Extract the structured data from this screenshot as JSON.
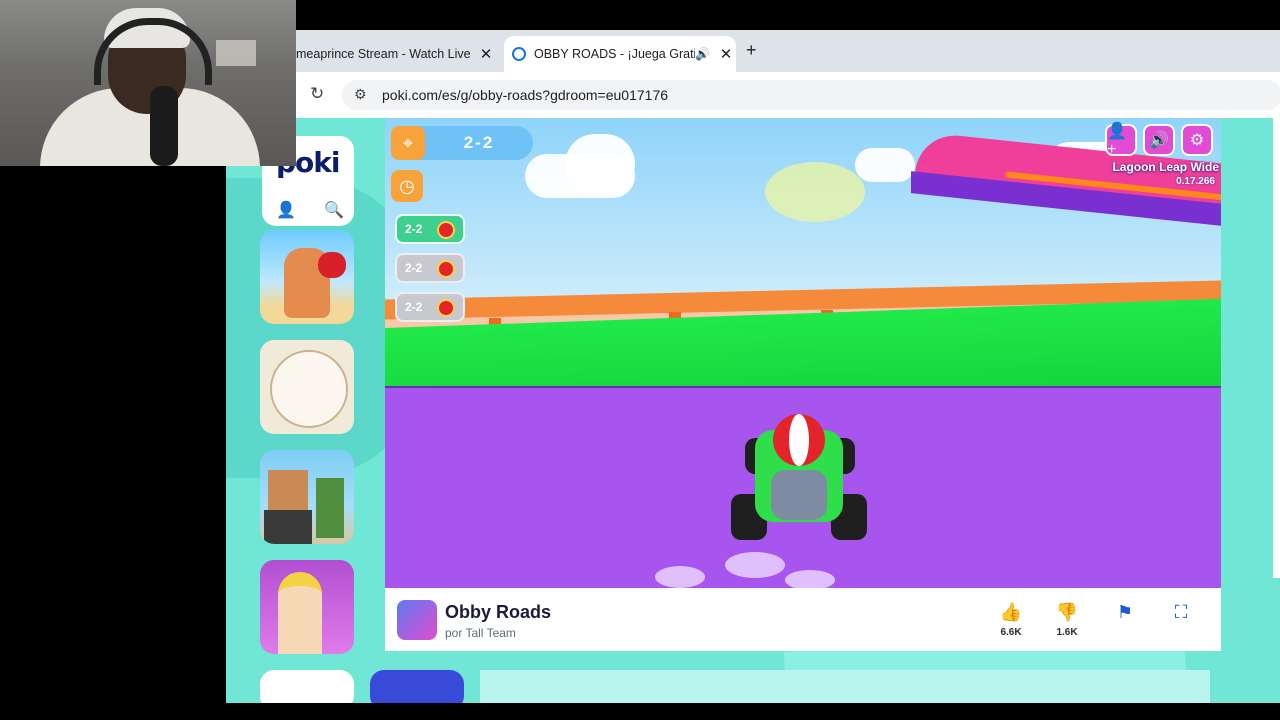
{
  "browser": {
    "tabs": [
      {
        "title": "meaprince Stream - Watch Live"
      },
      {
        "title": "OBBY ROADS - ¡Juega Grati"
      }
    ],
    "url": "poki.com/es/g/obby-roads?gdroom=eu017176"
  },
  "site": {
    "logo": "poki"
  },
  "game": {
    "level": "2-2",
    "racers": [
      {
        "level": "2-2"
      },
      {
        "level": "2-2"
      },
      {
        "level": "2-2"
      }
    ],
    "map_name": "Lagoon Leap Wide",
    "map_code": "0.17.266"
  },
  "info": {
    "title": "Obby Roads",
    "author": "por Tall Team",
    "likes": "6.6K",
    "dislikes": "1.6K"
  },
  "icons": [
    "close-icon",
    "speaker-icon",
    "plus-icon",
    "reload-icon",
    "tune-icon",
    "user-icon",
    "search-icon",
    "pin-icon",
    "timer-icon",
    "add-friend-icon",
    "sound-icon",
    "gear-icon",
    "thumbs-up-icon",
    "thumbs-down-icon",
    "flag-icon",
    "fullscreen-icon"
  ]
}
